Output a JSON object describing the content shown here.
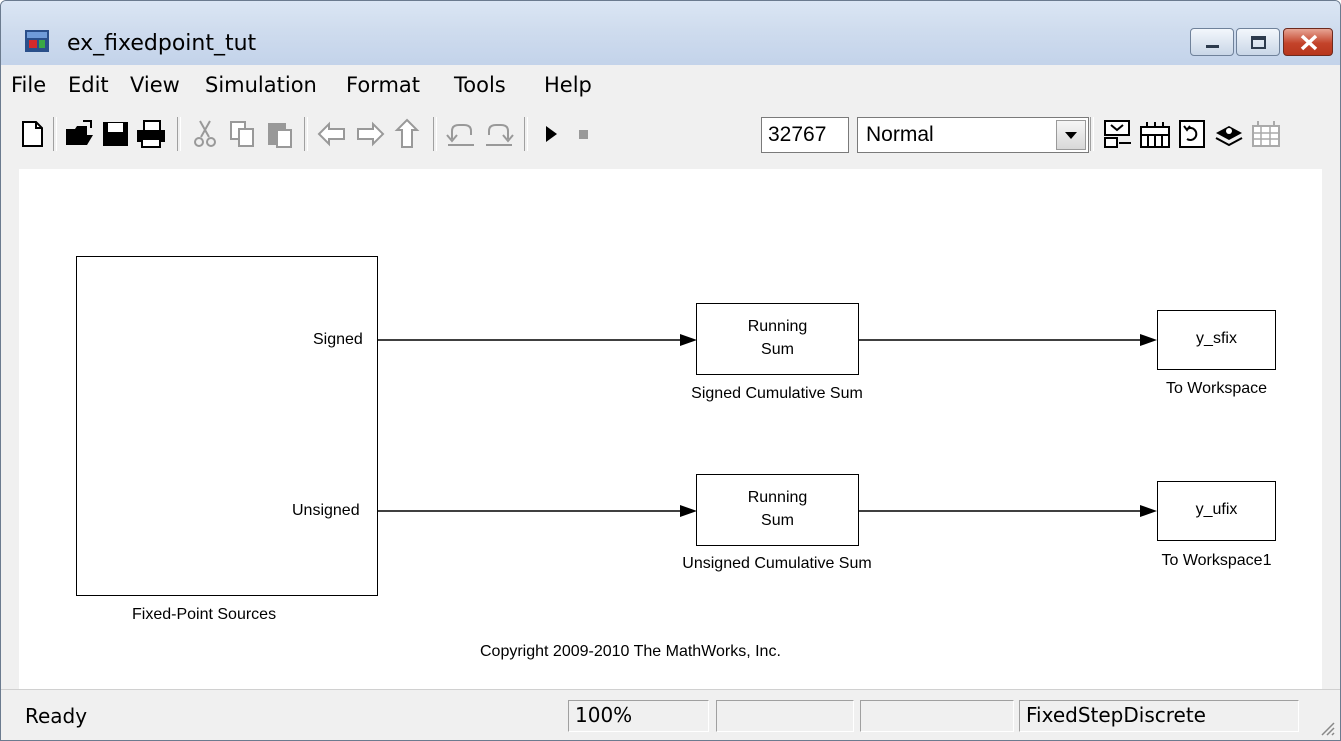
{
  "window": {
    "title": "ex_fixedpoint_tut"
  },
  "menu": {
    "items": [
      "File",
      "Edit",
      "View",
      "Simulation",
      "Format",
      "Tools",
      "Help"
    ]
  },
  "toolbar": {
    "stop_time": "32767",
    "sim_mode": "Normal",
    "icons": [
      "new-model-icon",
      "open-icon",
      "save-icon",
      "print-icon",
      "cut-icon",
      "copy-icon",
      "paste-icon",
      "back-icon",
      "forward-icon",
      "up-icon",
      "undo-icon",
      "redo-icon",
      "start-simulation-icon",
      "stop-simulation-icon",
      "build-icon",
      "library-browser-icon",
      "update-diagram-icon",
      "model-explorer-icon",
      "debug-icon"
    ]
  },
  "diagram": {
    "source_block": {
      "label": "Fixed-Point Sources",
      "port_signed": "Signed",
      "port_unsigned": "Unsigned"
    },
    "sum_signed": {
      "text_line1": "Running",
      "text_line2": "Sum",
      "label": "Signed Cumulative Sum"
    },
    "sum_unsigned": {
      "text_line1": "Running",
      "text_line2": "Sum",
      "label": "Unsigned Cumulative Sum"
    },
    "ws_signed": {
      "text": "y_sfix",
      "label": "To Workspace"
    },
    "ws_unsigned": {
      "text": "y_ufix",
      "label": "To Workspace1"
    },
    "copyright": "Copyright 2009-2010 The MathWorks, Inc."
  },
  "status": {
    "state": "Ready",
    "zoom": "100%",
    "pane3": "",
    "pane4": "",
    "solver": "FixedStepDiscrete"
  },
  "colors": {
    "title_bg": "#cfdcee",
    "close_button": "#c3432a",
    "canvas": "#ffffff"
  }
}
